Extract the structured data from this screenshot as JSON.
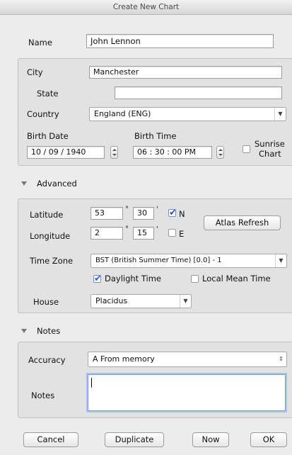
{
  "window": {
    "title": "Create New Chart"
  },
  "name_section": {
    "label": "Name",
    "value": "John Lennon"
  },
  "location": {
    "city_label": "City",
    "city_value": "Manchester",
    "state_label": "State",
    "state_value": "",
    "country_label": "Country",
    "country_value": "England (ENG)",
    "birth_date_label": "Birth Date",
    "birth_date_value": "10 / 09 / 1940",
    "birth_time_label": "Birth Time",
    "birth_time_value": "06 : 30 : 00 PM",
    "sunrise_label_1": "Sunrise",
    "sunrise_label_2": "Chart",
    "sunrise_checked": false
  },
  "advanced": {
    "header": "Advanced",
    "latitude_label": "Latitude",
    "lat_deg": "53",
    "lat_min": "30",
    "lat_dir": "N",
    "lat_checked": true,
    "longitude_label": "Longitude",
    "lon_deg": "2",
    "lon_min": "15",
    "lon_dir": "E",
    "lon_checked": false,
    "degree_symbol": "°",
    "minute_symbol": "'",
    "atlas_refresh_label": "Atlas Refresh",
    "timezone_label": "Time Zone",
    "timezone_value": "BST (British Summer Time) [0.0] - 1",
    "daylight_label": "Daylight Time",
    "daylight_checked": true,
    "local_mean_label": "Local Mean Time",
    "local_mean_checked": false,
    "house_label": "House",
    "house_value": "Placidus"
  },
  "notes": {
    "header": "Notes",
    "accuracy_label": "Accuracy",
    "accuracy_value": "A  From memory",
    "notes_label": "Notes",
    "notes_value": ""
  },
  "buttons": {
    "cancel": "Cancel",
    "duplicate": "Duplicate",
    "now": "Now",
    "ok": "OK"
  },
  "icons": {
    "check_mark": "✔",
    "select_arrow": "▼",
    "updown_arrows": "⇕"
  }
}
